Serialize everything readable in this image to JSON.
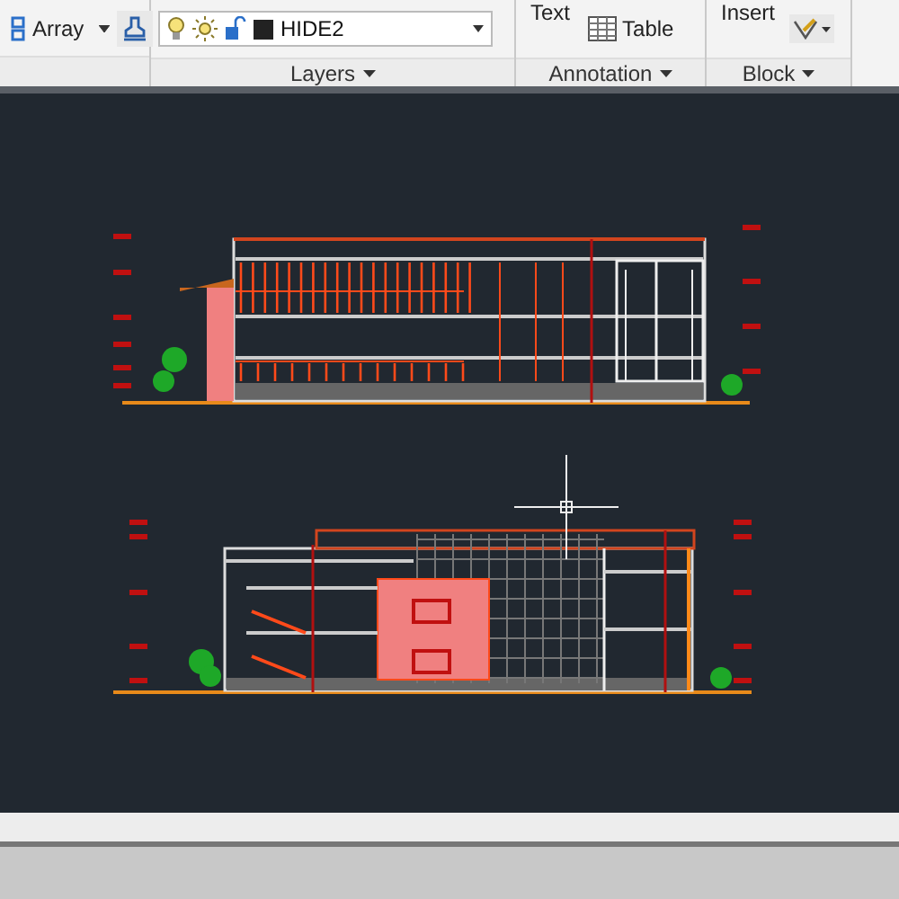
{
  "modify_panel": {
    "array_label": "Array"
  },
  "layers_panel": {
    "current_layer": "HIDE2",
    "label": "Layers"
  },
  "annotation_panel": {
    "text_label": "Text",
    "table_label": "Table",
    "label": "Annotation"
  },
  "block_panel": {
    "insert_label": "Insert",
    "label": "Block"
  }
}
